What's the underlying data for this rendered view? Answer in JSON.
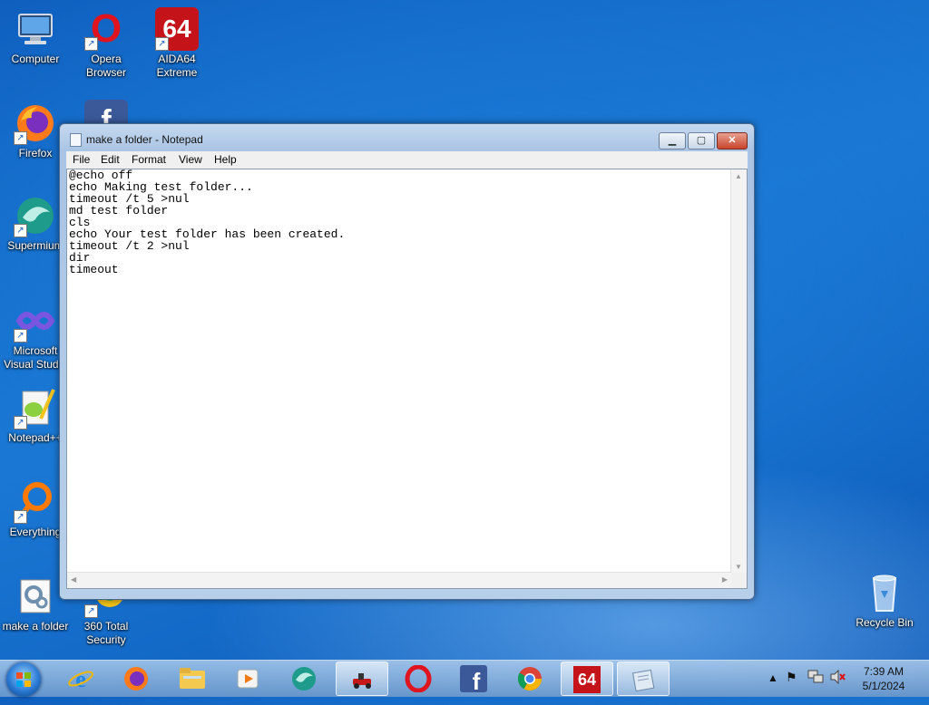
{
  "desktop": {
    "icons": [
      {
        "label": "Computer"
      },
      {
        "label": "Opera Browser"
      },
      {
        "label": "AIDA64 Extreme"
      },
      {
        "label": "Firefox"
      },
      {
        "label": "Supermium"
      },
      {
        "label": "Microsoft Visual Studio"
      },
      {
        "label": "Notepad++"
      },
      {
        "label": "Everything"
      },
      {
        "label": "make a folder"
      },
      {
        "label": "360 Total Security"
      },
      {
        "label": "Recycle Bin"
      }
    ],
    "aida_glyph": "64",
    "opera_glyph": "O",
    "facebook_glyph": "f"
  },
  "window": {
    "title": "make a folder - Notepad",
    "menu": [
      "File",
      "Edit",
      "Format",
      "View",
      "Help"
    ],
    "content": "@echo off\necho Making test folder...\ntimeout /t 5 >nul\nmd test folder\ncls\necho Your test folder has been created.\ntimeout /t 2 >nul\ndir\ntimeout"
  },
  "taskbar": {
    "pinned": [
      "Internet Explorer",
      "Firefox",
      "Windows Explorer",
      "Windows Media Player",
      "Supermium",
      "Game",
      "Opera",
      "Facebook",
      "Chrome",
      "AIDA64",
      "Notepad"
    ],
    "aida_glyph": "64",
    "clock": {
      "time": "7:39 AM",
      "date": "5/1/2024"
    }
  },
  "colors": {
    "accent": "#1a78d4",
    "close": "#c8452d"
  }
}
